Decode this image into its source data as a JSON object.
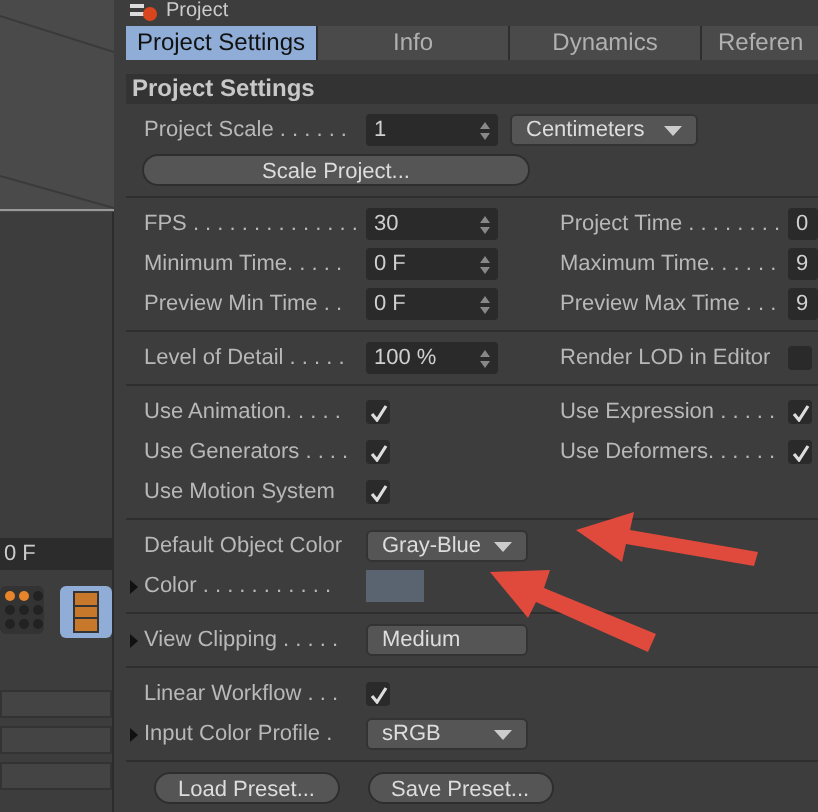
{
  "window": {
    "title": "Project"
  },
  "left_panel": {
    "time_field": "0 F"
  },
  "tabs": [
    {
      "label": "Project Settings",
      "selected": true
    },
    {
      "label": "Info",
      "selected": false
    },
    {
      "label": "Dynamics",
      "selected": false
    },
    {
      "label": "Referen",
      "selected": false
    }
  ],
  "section_title": "Project Settings",
  "groups": [
    [
      {
        "kind": "field",
        "label": "Project Scale . . . . . .",
        "value": "1",
        "extra": {
          "kind": "dropdown",
          "value": "Centimeters"
        }
      },
      {
        "kind": "button",
        "label": "Scale Project..."
      }
    ],
    [
      {
        "kind": "field",
        "label": "FPS . . . . . . . . . . . . . .",
        "value": "30",
        "right": {
          "kind": "field",
          "label": "Project Time . . . . . . . .",
          "value": "0"
        }
      },
      {
        "kind": "field",
        "label": "Minimum Time. . . . .",
        "value": "0 F",
        "right": {
          "kind": "field",
          "label": "Maximum Time. . . . . .",
          "value": "9"
        }
      },
      {
        "kind": "field",
        "label": "Preview Min Time . .",
        "value": "0 F",
        "right": {
          "kind": "field",
          "label": "Preview Max Time . . .",
          "value": "9"
        }
      }
    ],
    [
      {
        "kind": "field",
        "label": "Level of Detail . . . . .",
        "value": "100 %",
        "right": {
          "kind": "checkbox",
          "label": "Render LOD in Editor",
          "checked": false
        }
      }
    ],
    [
      {
        "kind": "checkbox",
        "label": "Use Animation. . . . .",
        "checked": true,
        "right": {
          "kind": "checkbox",
          "label": "Use Expression . . . . .",
          "checked": true
        }
      },
      {
        "kind": "checkbox",
        "label": "Use Generators . . . .",
        "checked": true,
        "right": {
          "kind": "checkbox",
          "label": "Use Deformers. . . . . .",
          "checked": true
        }
      },
      {
        "kind": "checkbox",
        "label": "Use Motion System",
        "checked": true
      }
    ],
    [
      {
        "kind": "dropdown",
        "label": "Default Object Color",
        "value": "Gray-Blue"
      },
      {
        "kind": "color",
        "label": "Color . . . . . . . . . . .",
        "expandable": true,
        "color": "#5a6470"
      }
    ],
    [
      {
        "kind": "dropdown",
        "label": "View Clipping . . . . .",
        "value": "Medium",
        "expandable": true,
        "arrow": false
      }
    ],
    [
      {
        "kind": "checkbox",
        "label": "Linear Workflow . . .",
        "checked": true
      },
      {
        "kind": "dropdown",
        "label": "Input Color Profile .",
        "value": "sRGB",
        "expandable": true
      }
    ]
  ],
  "buttons": [
    "Load Preset...",
    "Save Preset..."
  ]
}
